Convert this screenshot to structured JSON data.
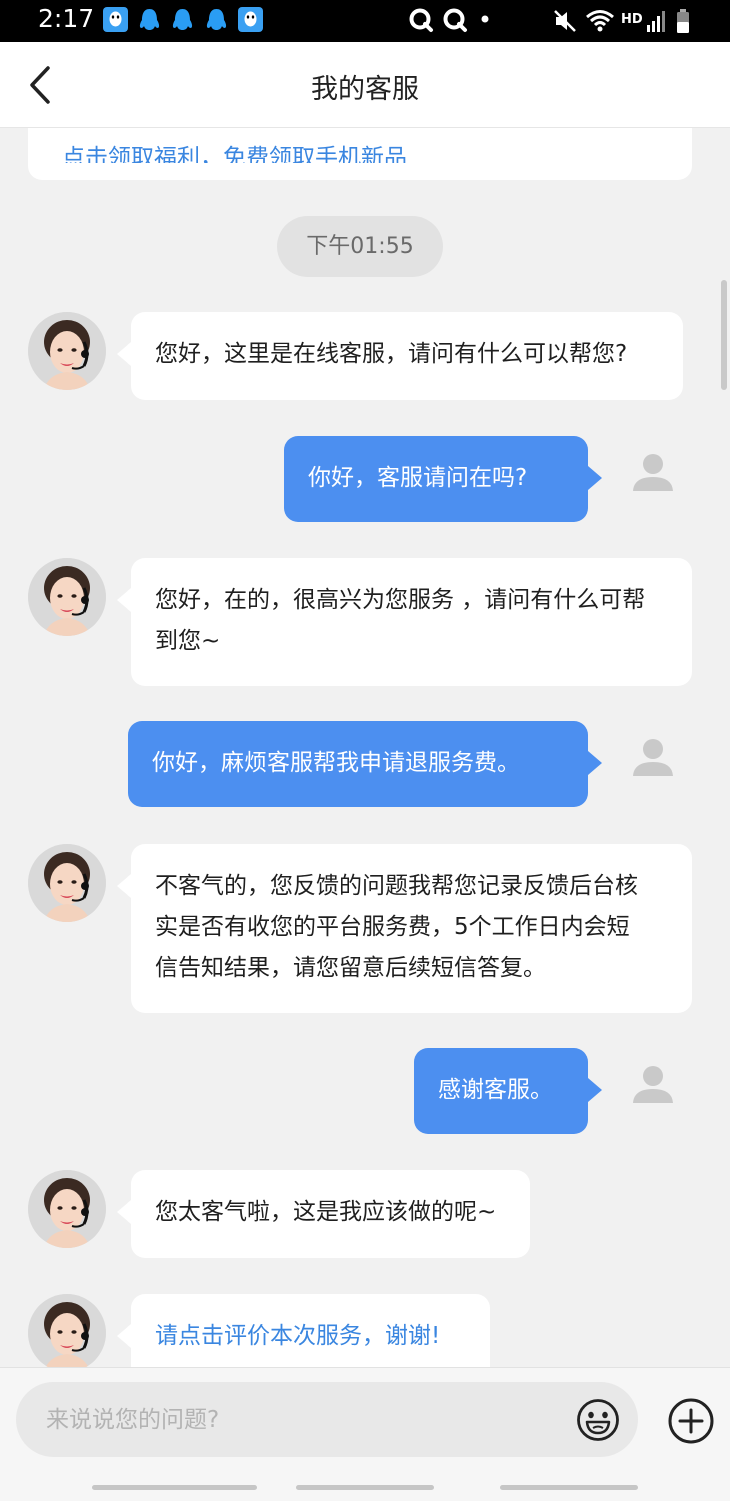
{
  "status_bar": {
    "time": "2:17",
    "network_label": "HD"
  },
  "header": {
    "title": "我的客服",
    "back_icon": "chevron-left-icon"
  },
  "chat": {
    "top_card_text": "点击领取福利，免费领取手机新品",
    "timestamp": "下午01:55",
    "messages": [
      {
        "side": "agent",
        "text": "您好，这里是在线客服，请问有什么可以帮您?"
      },
      {
        "side": "user",
        "text": "你好，客服请问在吗?"
      },
      {
        "side": "agent",
        "lines": [
          "您好，在的，很高兴为您服务 ，请问有什么可帮",
          "到您~"
        ]
      },
      {
        "side": "user",
        "text": "你好，麻烦客服帮我申请退服务费。"
      },
      {
        "side": "agent",
        "lines": [
          "不客气的，您反馈的问题我帮您记录反馈后台核",
          "实是否有收您的平台服务费，5个工作日内会短",
          "信告知结果，请您留意后续短信答复。"
        ]
      },
      {
        "side": "user",
        "text": "感谢客服。"
      },
      {
        "side": "agent",
        "text": "您太客气啦，这是我应该做的呢~"
      },
      {
        "side": "agent",
        "text": "请点击评价本次服务，谢谢!",
        "link": true
      }
    ]
  },
  "input_bar": {
    "placeholder": "来说说您的问题?",
    "emoji_icon": "emoji-face-icon",
    "plus_icon": "plus-circle-icon"
  },
  "colors": {
    "accent": "#4c8ff0",
    "link": "#3a86e0",
    "background": "#f1f1f1"
  }
}
